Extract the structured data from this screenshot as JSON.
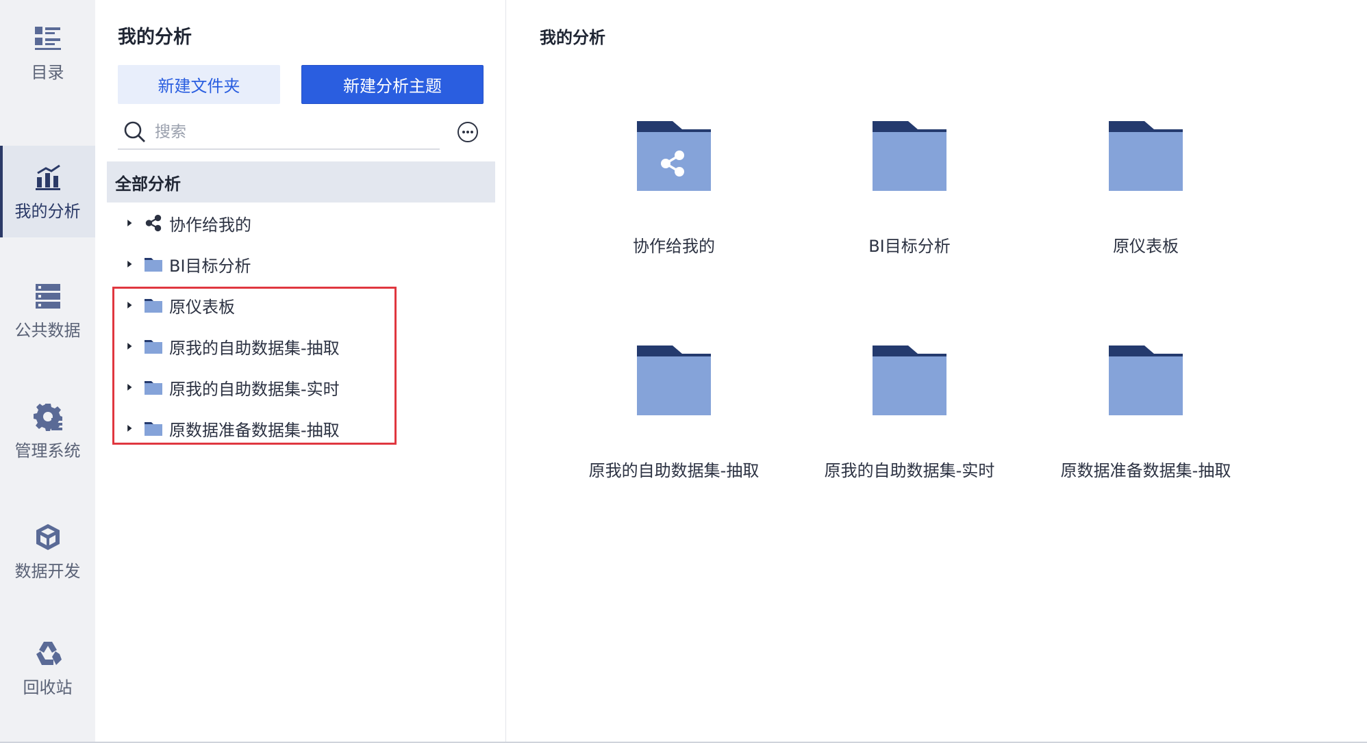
{
  "nav": {
    "items": [
      {
        "label": "目录",
        "icon": "list-icon",
        "active": false
      },
      {
        "label": "我的分析",
        "icon": "chart-icon",
        "active": true
      },
      {
        "label": "公共数据",
        "icon": "database-icon",
        "active": false
      },
      {
        "label": "管理系统",
        "icon": "gear-icon",
        "active": false
      },
      {
        "label": "数据开发",
        "icon": "cubes-icon",
        "active": false
      },
      {
        "label": "回收站",
        "icon": "recycle-icon",
        "active": false
      }
    ]
  },
  "tree_panel": {
    "title": "我的分析",
    "new_folder_label": "新建文件夹",
    "new_topic_label": "新建分析主题",
    "search": {
      "placeholder": "搜索",
      "value": ""
    },
    "root_label": "全部分析",
    "items": [
      {
        "label": "协作给我的",
        "icon": "share-icon"
      },
      {
        "label": "BI目标分析",
        "icon": "folder-icon"
      },
      {
        "label": "原仪表板",
        "icon": "folder-icon"
      },
      {
        "label": "原我的自助数据集-抽取",
        "icon": "folder-icon"
      },
      {
        "label": "原我的自助数据集-实时",
        "icon": "folder-icon"
      },
      {
        "label": "原数据准备数据集-抽取",
        "icon": "folder-icon"
      }
    ]
  },
  "main": {
    "title": "我的分析",
    "tiles": [
      {
        "label": "协作给我的",
        "icon": "shared-folder-icon"
      },
      {
        "label": "BI目标分析",
        "icon": "folder-icon"
      },
      {
        "label": "原仪表板",
        "icon": "folder-icon"
      },
      {
        "label": "原我的自助数据集-抽取",
        "icon": "folder-icon"
      },
      {
        "label": "原我的自助数据集-实时",
        "icon": "folder-icon"
      },
      {
        "label": "原数据准备数据集-抽取",
        "icon": "folder-icon"
      }
    ]
  },
  "colors": {
    "primary": "#2a5ee0",
    "folder_body": "#85a3d9",
    "folder_tab": "#243a6e",
    "highlight": "#e0373f"
  }
}
